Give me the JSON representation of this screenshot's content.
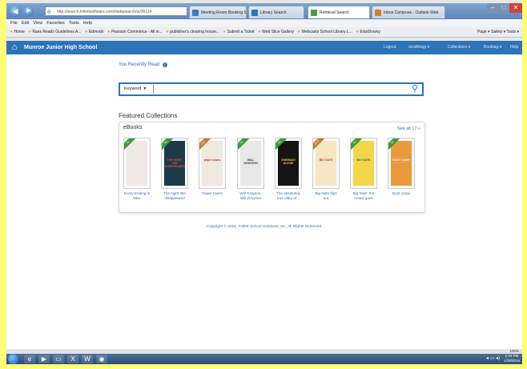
{
  "browser": {
    "address": "http://search.follettsoftware.com/metasearch/ui/36114",
    "tabs": [
      {
        "label": "Meeting Room Booking System",
        "color": "#3b7cc4"
      },
      {
        "label": "Library Search",
        "color": "#2d73b8"
      },
      {
        "label": "Retrieval Search",
        "color": "#4a9d4a"
      },
      {
        "label": "Inbox Compose - Outlook Web",
        "color": "#d97e1e"
      }
    ],
    "menu": [
      "File",
      "Edit",
      "View",
      "Favorites",
      "Tools",
      "Help"
    ],
    "favorites": [
      "Home",
      "Raes Reads Guidelines A...",
      "Edmodo",
      "Pearson Commerce - All in...",
      "publisher's clearing house...",
      "Submit a Ticket",
      "Web Slice Gallery",
      "Webcasts School Library L...",
      "EdutDowny"
    ],
    "toolbar_items": "Page ▾  Safety ▾  Tools ▾",
    "status_zoom": "100%"
  },
  "site": {
    "school_name": "Munroe Junior High School",
    "nav": [
      "Logout",
      "mcollinsgr ▾",
      "Collections ▾",
      "Booktag ▾",
      "Help"
    ],
    "recently_read": "You Recently Read",
    "search": {
      "scope": "Keyword",
      "placeholder": ""
    },
    "featured_title": "Featured Collections",
    "collection": {
      "name": "eBooks",
      "see_all": "See all 17 »",
      "books": [
        {
          "title": "Every Ending is New",
          "badge": "IN",
          "cover": "#f1e9e6",
          "text_color": "#b03040",
          "cover_text": ""
        },
        {
          "title": "The night she disappeared",
          "badge": "IN",
          "cover": "#1d3a4a",
          "text_color": "#e14b3b",
          "cover_text": "THE NIGHT SHE DISAPPEARED"
        },
        {
          "title": "Paper towns",
          "badge": "OUT",
          "cover": "#efe9df",
          "text_color": "#c0302a",
          "cover_text": "paper towns"
        },
        {
          "title": "Will Grayson, Will Grayson",
          "badge": "IN",
          "cover": "#e8e8e8",
          "text_color": "#333",
          "cover_text": "WILL GRAYSON"
        },
        {
          "title": "The absolutely true diary of...",
          "badge": "IN",
          "cover": "#151515",
          "text_color": "#e8c63a",
          "cover_text": "SHERMAN ALEXIE"
        },
        {
          "title": "Big Nate flips out",
          "badge": "OUT",
          "cover": "#f6e6c3",
          "text_color": "#d3322a",
          "cover_text": "BIG NATE"
        },
        {
          "title": "Big Nate: the crowd goes",
          "badge": "IN",
          "cover": "#f5d64b",
          "text_color": "#2a7a2a",
          "cover_text": "BIG NATE"
        },
        {
          "title": "Boot camp",
          "badge": "IN",
          "cover": "#ea9a3a",
          "text_color": "#fff",
          "cover_text": "BOOT CAMP"
        }
      ]
    },
    "copyright": "Copyright © 2015. Follett School Solutions, Inc. All Rights Reserved."
  },
  "taskbar": {
    "clock_time": "1:34 PM",
    "clock_date": "1/28/2016"
  },
  "colors": {
    "accent": "#2d73b8",
    "badge_in": "#3a9d3a",
    "badge_out": "#c9792a"
  }
}
